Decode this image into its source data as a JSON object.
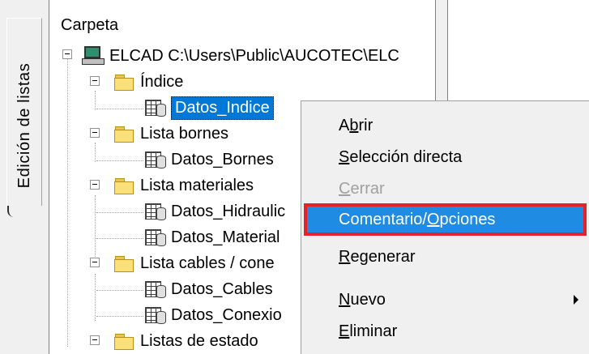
{
  "vertical_tab": {
    "label": "Edición de listas"
  },
  "tree": {
    "header": "Carpeta",
    "root_label": "ELCAD C:\\Users\\Public\\AUCOTEC\\ELC",
    "nodes": [
      {
        "label": "Índice",
        "type": "folder"
      },
      {
        "label": "Datos_Indice",
        "type": "db",
        "selected": true
      },
      {
        "label": "Lista bornes",
        "type": "folder"
      },
      {
        "label": "Datos_Bornes",
        "type": "db"
      },
      {
        "label": "Lista materiales",
        "type": "folder"
      },
      {
        "label": "Datos_Hidraulic",
        "type": "db"
      },
      {
        "label": "Datos_Material",
        "type": "db"
      },
      {
        "label": "Lista cables / cone",
        "type": "folder"
      },
      {
        "label": "Datos_Cables",
        "type": "db"
      },
      {
        "label": "Datos_Conexio",
        "type": "db"
      },
      {
        "label": "Listas de estado",
        "type": "folder"
      }
    ]
  },
  "context_menu": {
    "items": [
      {
        "pre": "A",
        "u": "b",
        "post": "rir",
        "disabled": false
      },
      {
        "pre": "",
        "u": "S",
        "post": "elección directa",
        "disabled": false
      },
      {
        "pre": "",
        "u": "C",
        "post": "errar",
        "disabled": true
      },
      {
        "pre": "Comentario/",
        "u": "O",
        "post": "pciones",
        "disabled": false,
        "highlighted": true
      },
      {
        "pre": "",
        "u": "R",
        "post": "egenerar",
        "disabled": false
      },
      {
        "pre": "",
        "u": "N",
        "post": "uevo",
        "disabled": false,
        "submenu": true
      },
      {
        "pre": "",
        "u": "E",
        "post": "liminar",
        "disabled": false
      }
    ]
  },
  "colors": {
    "selection": "#0078d7",
    "menu_highlight": "#1f8be3",
    "highlight_border": "#e8202a"
  }
}
